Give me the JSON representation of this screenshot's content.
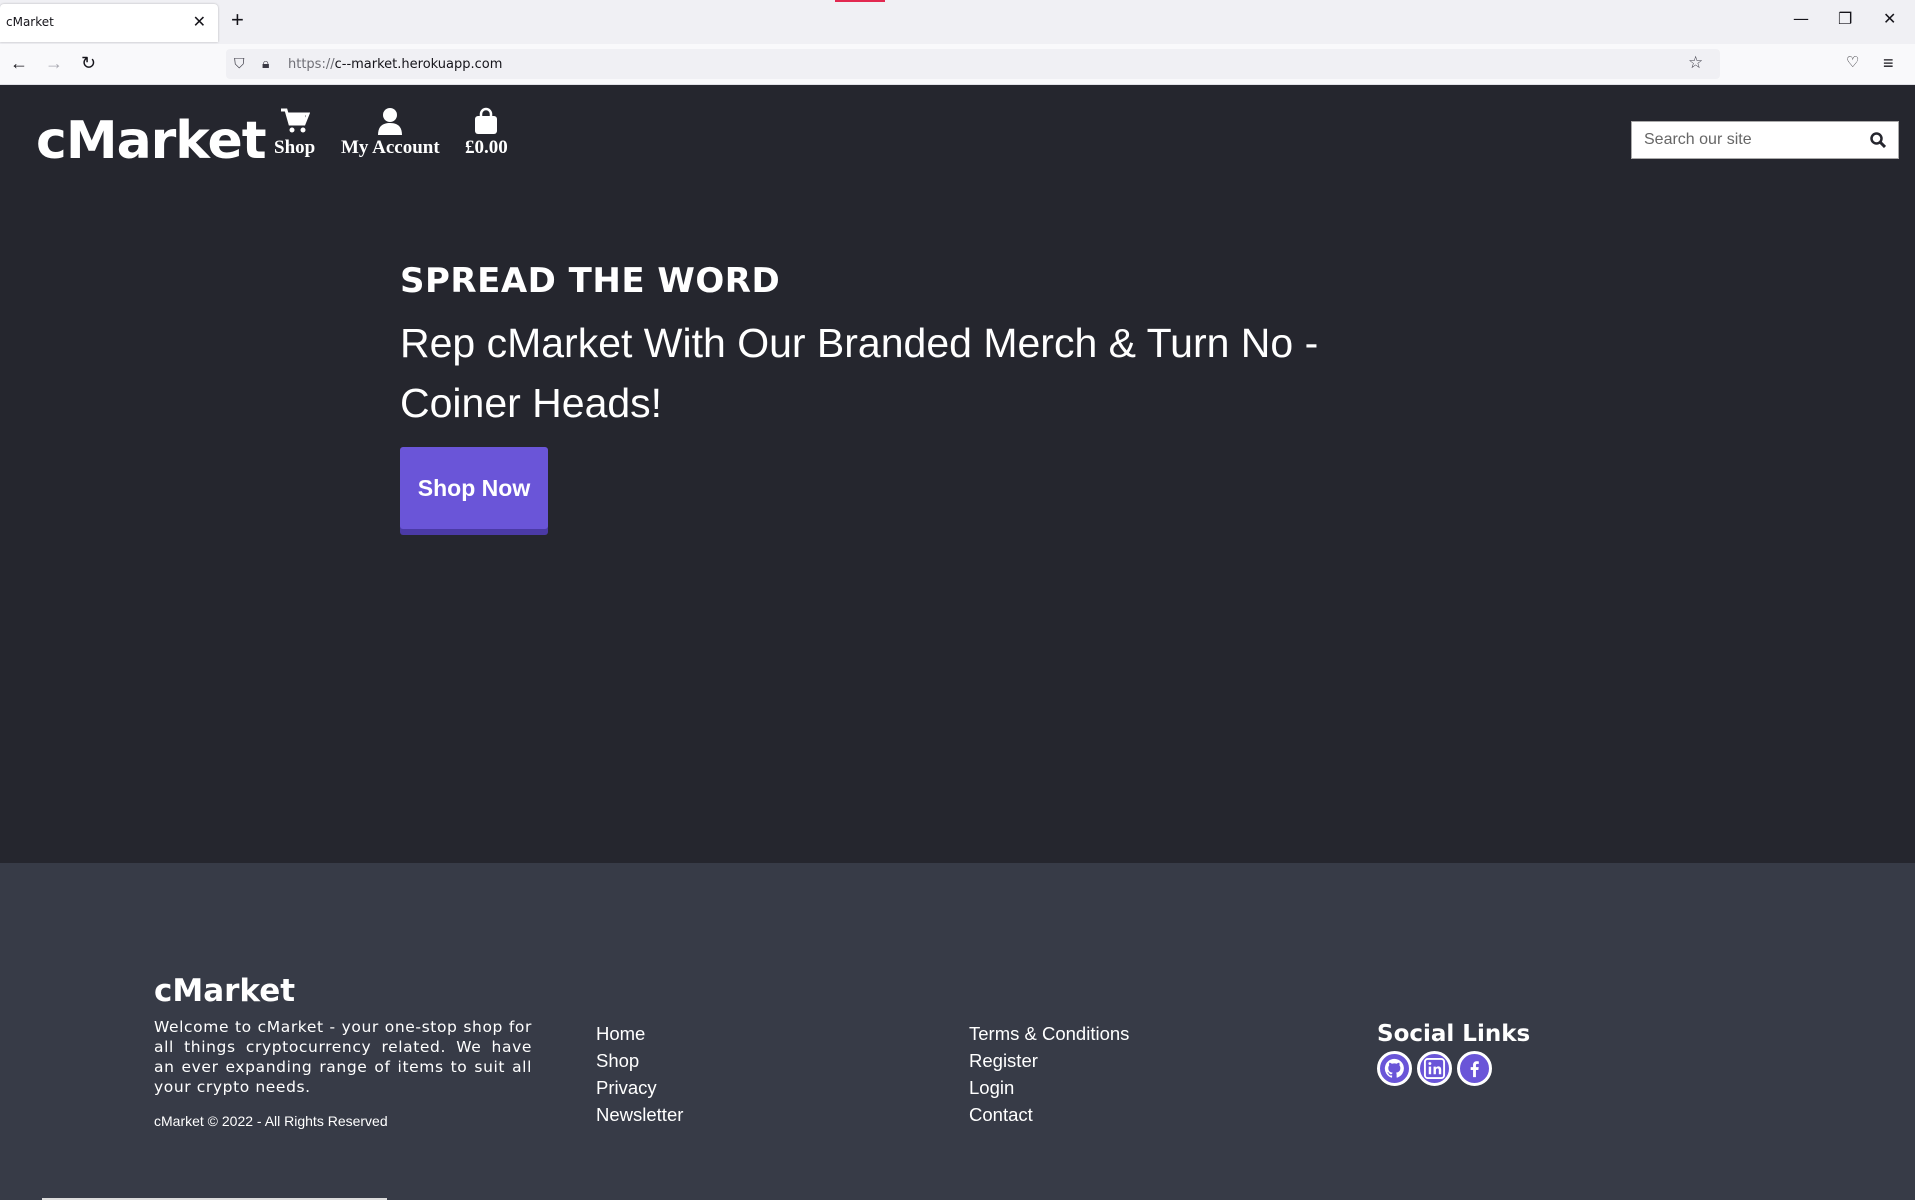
{
  "browser": {
    "tab_title": "cMarket",
    "url_prefix": "https://",
    "url_host": "c--market.herokuapp.com"
  },
  "header": {
    "logo": "cMarket",
    "nav": [
      {
        "label": "Shop",
        "icon": "cart-icon"
      },
      {
        "label": "My Account",
        "icon": "user-icon"
      },
      {
        "label": "£0.00",
        "icon": "shopping-bag-icon"
      }
    ],
    "search": {
      "placeholder": "Search our site",
      "icon": "search-icon"
    }
  },
  "hero": {
    "eyebrow": "SPREAD THE WORD",
    "headline": "Rep cMarket With Our Branded Merch & Turn No - Coiner Heads!",
    "cta": "Shop Now"
  },
  "footer": {
    "logo": "cMarket",
    "about": "Welcome to cMarket - your one-stop shop for all things cryptocurrency related. We have an ever expanding range of items to suit all your crypto needs.",
    "copyright": "cMarket © 2022 - All Rights Reserved",
    "links_col1": [
      "Home",
      "Shop",
      "Privacy",
      "Newsletter"
    ],
    "links_col2": [
      "Terms & Conditions",
      "Register",
      "Login",
      "Contact"
    ],
    "social_title": "Social Links",
    "social": [
      {
        "icon": "github-icon"
      },
      {
        "icon": "linkedin-icon"
      },
      {
        "icon": "facebook-icon"
      }
    ]
  },
  "colors": {
    "page_bg": "#25262e",
    "footer_bg": "#373b47",
    "accent": "#6a55d8"
  }
}
